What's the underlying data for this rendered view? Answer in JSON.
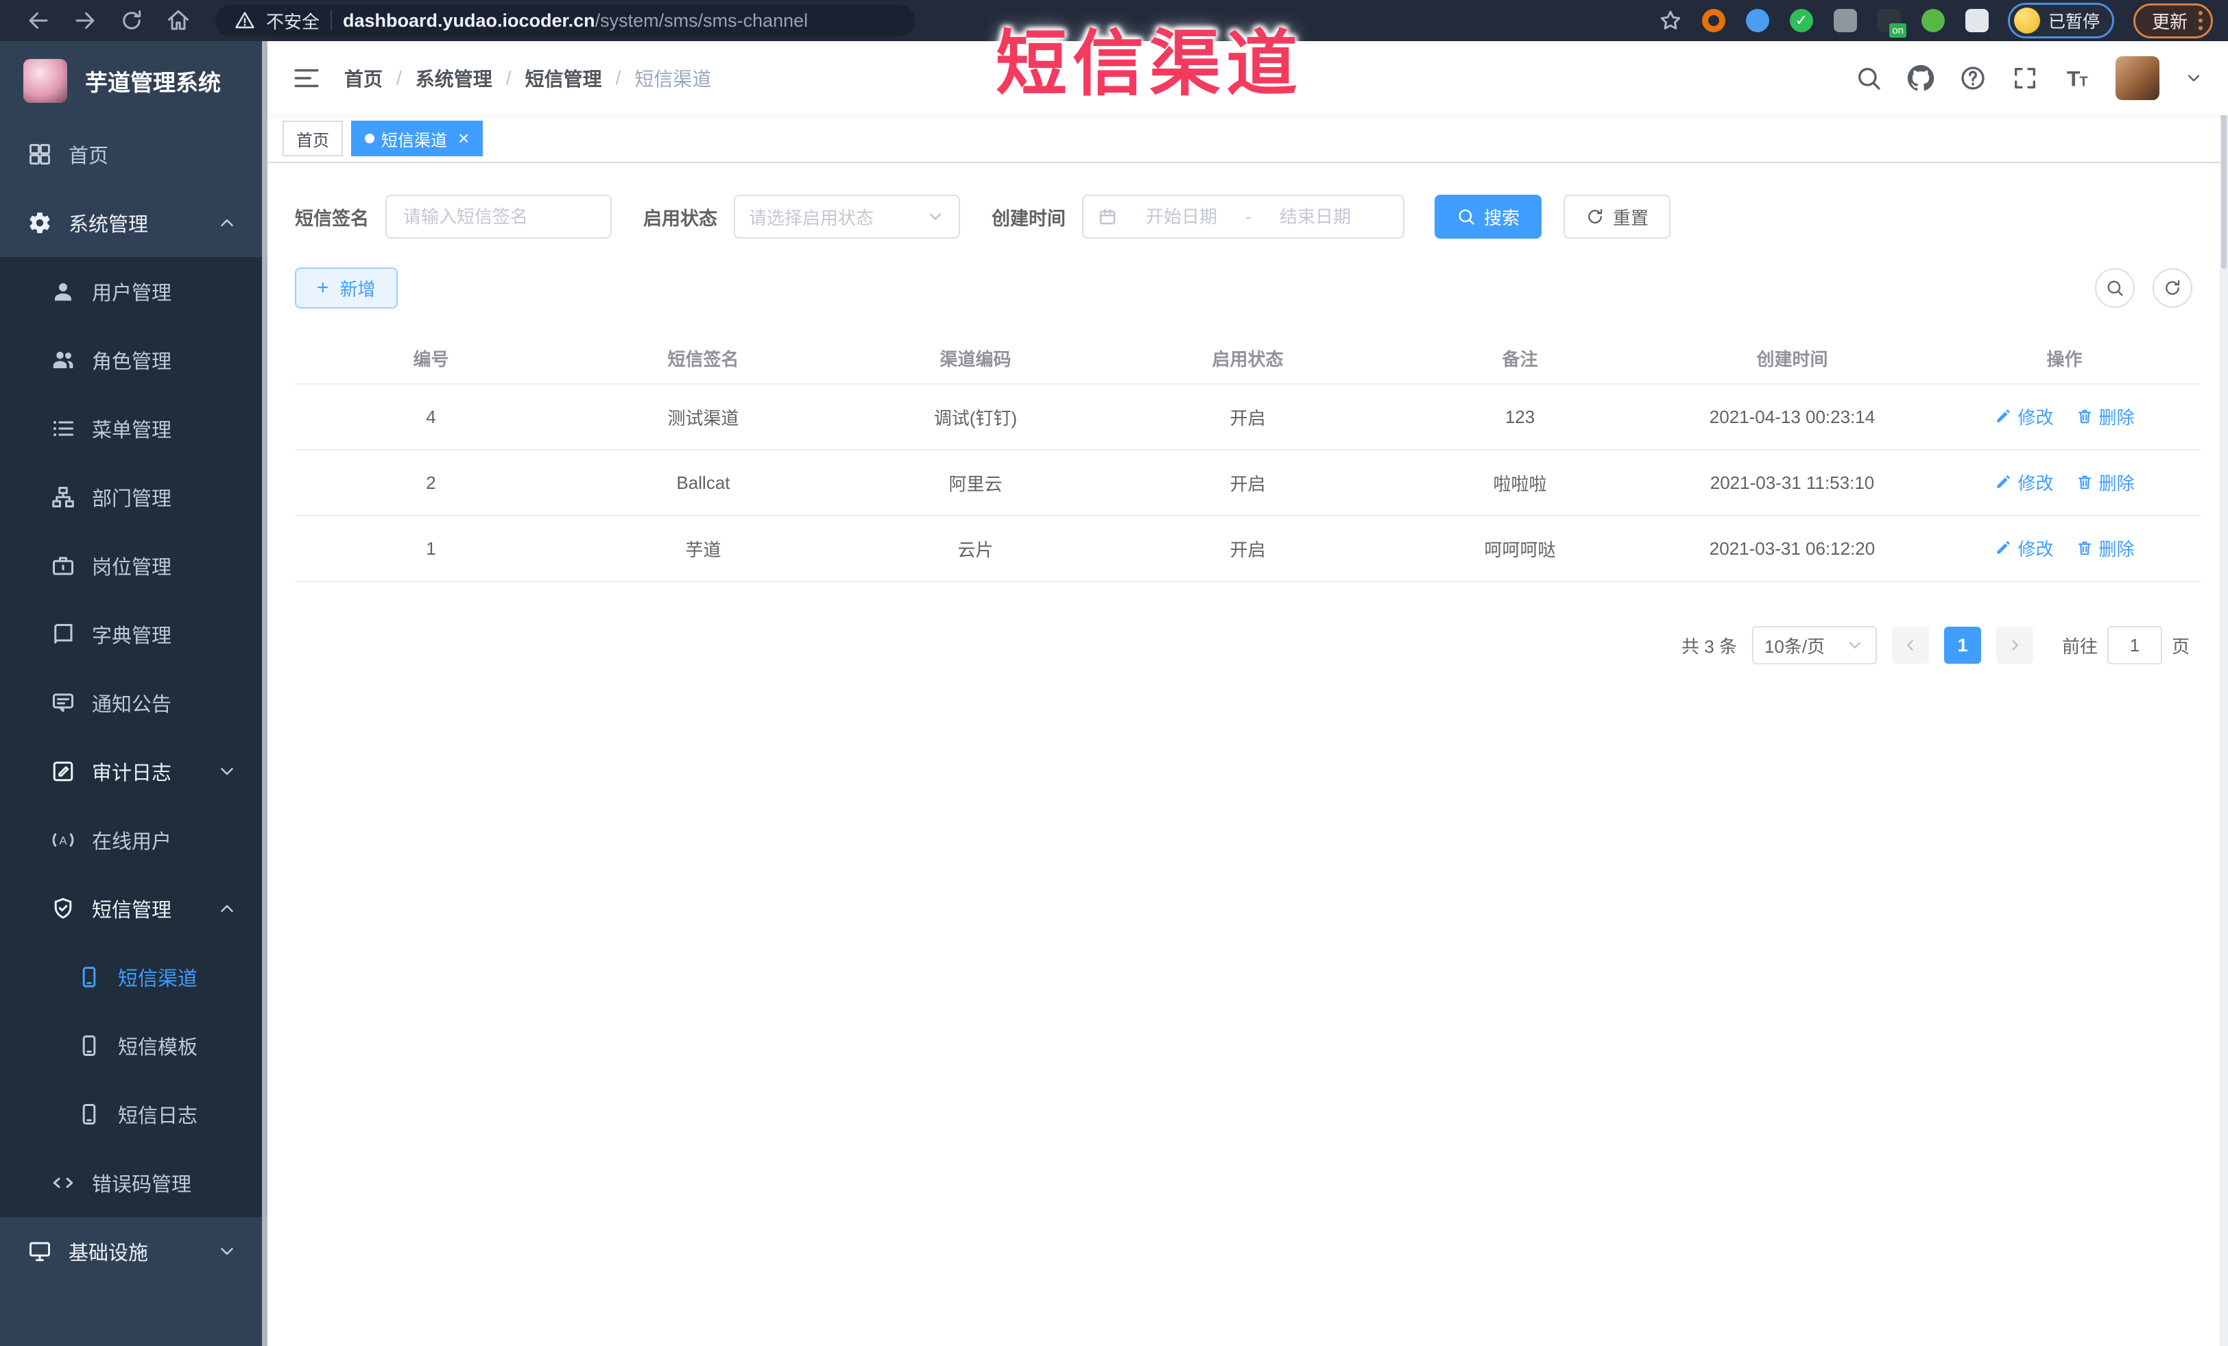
{
  "colors": {
    "accent": "#409eff",
    "sidebar_bg": "#304156",
    "submenu_bg": "#1f2d3d",
    "annotation": "#f43a5e",
    "tab_active": "#409eff"
  },
  "annotation": {
    "text": "短信渠道"
  },
  "browser": {
    "security_label": "不安全",
    "url_domain": "dashboard.yudao.iocoder.cn",
    "url_path": "/system/sms/sms-channel",
    "paused_badge": "已暂停",
    "update_button": "更新",
    "extensions": [
      {
        "name": "orange-ring",
        "shape": "ring",
        "color": "#e8710a"
      },
      {
        "name": "blue-pin",
        "shape": "dot",
        "color": "#4a9df0"
      },
      {
        "name": "green-check",
        "shape": "check",
        "color": "#2fbe57"
      },
      {
        "name": "gray-grid",
        "shape": "square",
        "color": "#8f969e"
      },
      {
        "name": "dark-on-badge",
        "shape": "onbadge",
        "color": "#30363d"
      },
      {
        "name": "green-sprout",
        "shape": "dot",
        "color": "#57b846"
      },
      {
        "name": "white-puzzle",
        "shape": "square",
        "color": "#e4e7ea"
      }
    ]
  },
  "sidebar": {
    "title": "芋道管理系统",
    "items": [
      {
        "name": "home",
        "label": "首页",
        "icon": "dashboard",
        "level": 0,
        "sub": false
      },
      {
        "name": "system-management",
        "label": "系统管理",
        "icon": "gear",
        "level": 0,
        "sub": false,
        "caret": "up"
      },
      {
        "name": "user-management",
        "label": "用户管理",
        "icon": "user",
        "level": 1,
        "sub": true
      },
      {
        "name": "role-management",
        "label": "角色管理",
        "icon": "users",
        "level": 1,
        "sub": true
      },
      {
        "name": "menu-management",
        "label": "菜单管理",
        "icon": "menulist",
        "level": 1,
        "sub": true
      },
      {
        "name": "department-management",
        "label": "部门管理",
        "icon": "orgtree",
        "level": 1,
        "sub": true
      },
      {
        "name": "post-management",
        "label": "岗位管理",
        "icon": "briefcase",
        "level": 1,
        "sub": true
      },
      {
        "name": "dict-management",
        "label": "字典管理",
        "icon": "book",
        "level": 1,
        "sub": true
      },
      {
        "name": "notice-announcement",
        "label": "通知公告",
        "icon": "board",
        "level": 1,
        "sub": true
      },
      {
        "name": "audit-log",
        "label": "审计日志",
        "icon": "auditlog",
        "level": 1,
        "sub": true,
        "caret": "down"
      },
      {
        "name": "online-users",
        "label": "在线用户",
        "icon": "online",
        "level": 1,
        "sub": true
      },
      {
        "name": "sms-management",
        "label": "短信管理",
        "icon": "shield",
        "level": 1,
        "sub": true,
        "caret": "up"
      },
      {
        "name": "sms-channel",
        "label": "短信渠道",
        "icon": "mobile",
        "level": 2,
        "sub": true,
        "active": true
      },
      {
        "name": "sms-template",
        "label": "短信模板",
        "icon": "mobile",
        "level": 2,
        "sub": true
      },
      {
        "name": "sms-log",
        "label": "短信日志",
        "icon": "mobile",
        "level": 2,
        "sub": true
      },
      {
        "name": "error-code-management",
        "label": "错误码管理",
        "icon": "code",
        "level": 1,
        "sub": true
      },
      {
        "name": "infrastructure",
        "label": "基础设施",
        "icon": "monitor",
        "level": 0,
        "sub": false,
        "caret": "down"
      }
    ]
  },
  "navbar": {
    "breadcrumb": [
      "首页",
      "系统管理",
      "短信管理",
      "短信渠道"
    ]
  },
  "tabs": [
    {
      "name": "home",
      "label": "首页",
      "active": false,
      "closable": false
    },
    {
      "name": "sms-channel",
      "label": "短信渠道",
      "active": true,
      "closable": true
    }
  ],
  "filters": {
    "sign_label": "短信签名",
    "sign_placeholder": "请输入短信签名",
    "status_label": "启用状态",
    "status_placeholder": "请选择启用状态",
    "time_label": "创建时间",
    "start_placeholder": "开始日期",
    "separator": "-",
    "end_placeholder": "结束日期",
    "search_button": "搜索",
    "reset_button": "重置"
  },
  "toolbar": {
    "add_button": "新增"
  },
  "table": {
    "headers": [
      "编号",
      "短信签名",
      "渠道编码",
      "启用状态",
      "备注",
      "创建时间",
      "操作"
    ],
    "rows": [
      {
        "id": "4",
        "sign": "测试渠道",
        "code": "调试(钉钉)",
        "status": "开启",
        "remark": "123",
        "created": "2021-04-13 00:23:14"
      },
      {
        "id": "2",
        "sign": "Ballcat",
        "code": "阿里云",
        "status": "开启",
        "remark": "啦啦啦",
        "created": "2021-03-31 11:53:10"
      },
      {
        "id": "1",
        "sign": "芋道",
        "code": "云片",
        "status": "开启",
        "remark": "呵呵呵哒",
        "created": "2021-03-31 06:12:20"
      }
    ],
    "edit_label": "修改",
    "delete_label": "删除"
  },
  "pagination": {
    "total": "共 3 条",
    "page_size": "10条/页",
    "current_page": "1",
    "goto_label": "前往",
    "goto_value": "1",
    "page_label": "页"
  }
}
